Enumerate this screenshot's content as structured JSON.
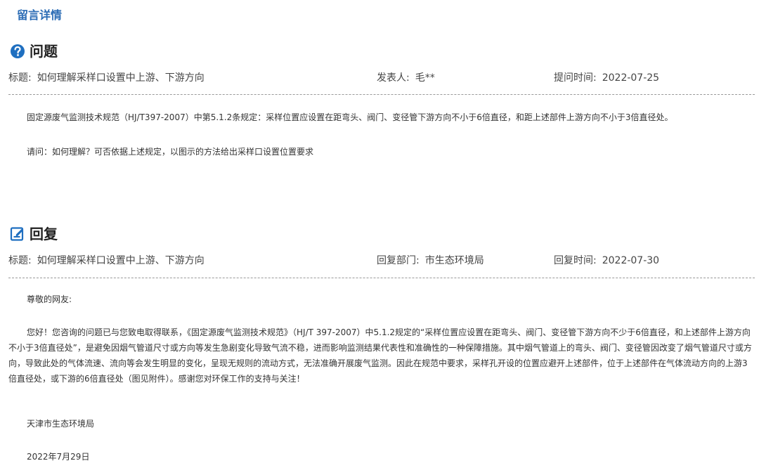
{
  "page": {
    "title": "留言详情"
  },
  "question": {
    "heading": "问题",
    "title_label": "标题:",
    "title_value": "如何理解采样口设置中上游、下游方向",
    "author_label": "发表人:",
    "author_value": "毛**",
    "time_label": "提问时间:",
    "time_value": "2022-07-25",
    "paragraphs": [
      "固定源废气监测技术规范（HJ/T397-2007）中第5.1.2条规定：采样位置应设置在距弯头、阀门、变径管下游方向不小于6倍直径，和距上述部件上游方向不小于3倍直径处。",
      "请问：如何理解？可否依据上述规定，以图示的方法给出采样口设置位置要求"
    ]
  },
  "reply": {
    "heading": "回复",
    "title_label": "标题:",
    "title_value": "如何理解采样口设置中上游、下游方向",
    "dept_label": "回复部门:",
    "dept_value": "市生态环境局",
    "time_label": "回复时间:",
    "time_value": "2022-07-30",
    "greeting": "尊敬的网友:",
    "body": "您好！您咨询的问题已与您致电取得联系，《固定源废气监测技术规范》（HJ/T 397-2007）中5.1.2规定的“采样位置应设置在距弯头、阀门、变径管下游方向不少于6倍直径，和上述部件上游方向不小于3倍直径处”，是避免因烟气管道尺寸或方向等发生急剧变化导致气流不稳，进而影响监测结果代表性和准确性的一种保障措施。其中烟气管道上的弯头、阀门、变径管因改变了烟气管道尺寸或方向，导致此处的气体流速、流向等会发生明显的变化，呈现无规则的流动方式，无法准确开展废气监测。因此在规范中要求，采样孔开设的位置应避开上述部件，位于上述部件在气体流动方向的上游3倍直径处，或下游的6倍直径处（图见附件）。感谢您对环保工作的支持与关注！",
    "signature": "天津市生态环境局",
    "date": "2022年7月29日"
  },
  "icons": {
    "question": "question-circle-icon",
    "reply": "edit-document-icon"
  },
  "colors": {
    "title_blue": "#2b6cb5",
    "icon_blue": "#1f6fc0"
  }
}
